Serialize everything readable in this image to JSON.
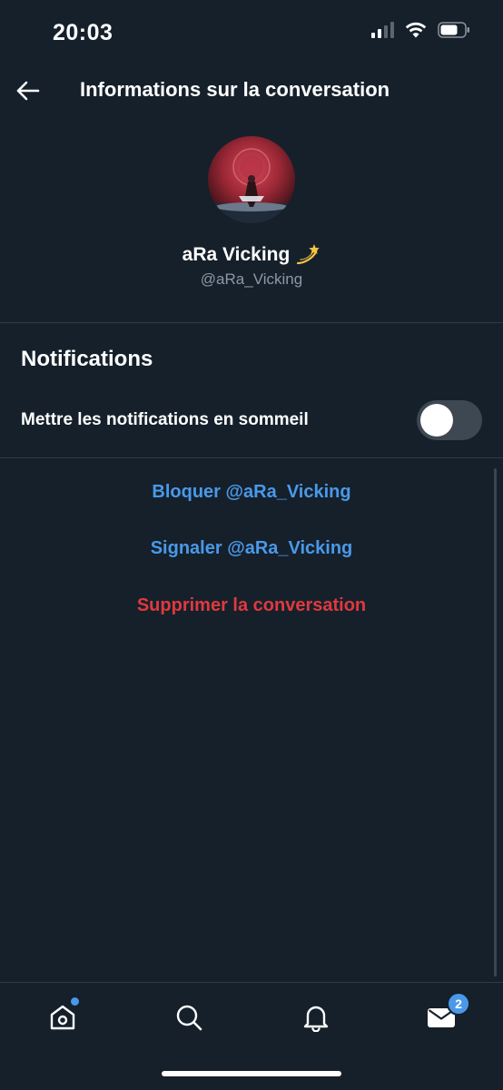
{
  "status_bar": {
    "time": "20:03"
  },
  "header": {
    "title": "Informations sur la conversation"
  },
  "profile": {
    "display_name": "aRa Vicking",
    "handle": "@aRa_Vicking",
    "name_emoji": "dizzy-icon"
  },
  "notifications": {
    "heading": "Notifications",
    "snooze_label": "Mettre les notifications en sommeil",
    "snooze_enabled": false
  },
  "actions": {
    "block": "Bloquer @aRa_Vicking",
    "report": "Signaler @aRa_Vicking",
    "delete": "Supprimer la conversation"
  },
  "tab_bar": {
    "items": [
      "home-icon",
      "search-icon",
      "bell-icon",
      "mail-icon"
    ],
    "messages_badge": "2"
  },
  "colors": {
    "background": "#15202b",
    "accent": "#4a99e9",
    "danger": "#e0393e",
    "secondary_text": "#8b98a5"
  }
}
